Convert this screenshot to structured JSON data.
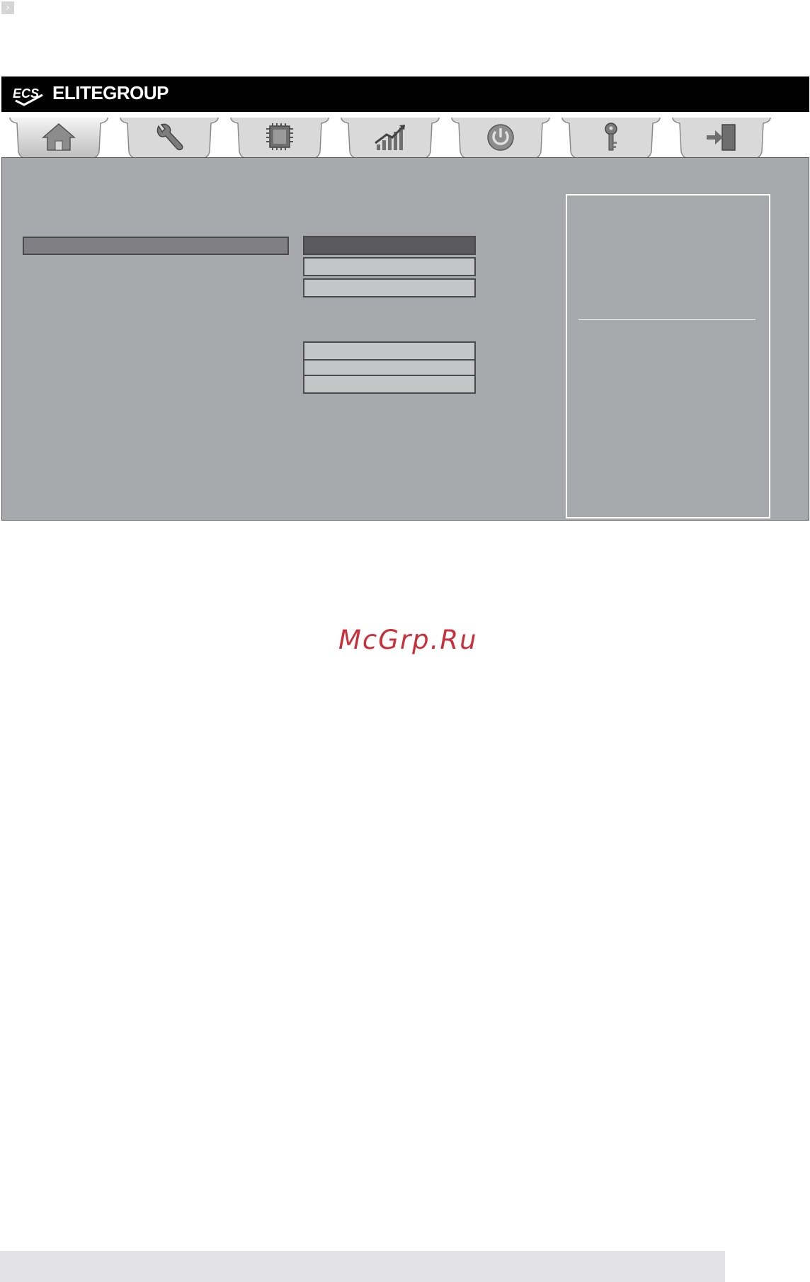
{
  "page": {
    "marker_glyph": "›",
    "watermark": "McGrp.Ru"
  },
  "bios": {
    "brand": {
      "logo_text": "ECS",
      "name": "ELITEGROUP"
    },
    "tabs": [
      {
        "id": "main",
        "icon": "home-icon"
      },
      {
        "id": "advanced",
        "icon": "wrench-icon"
      },
      {
        "id": "chipset",
        "icon": "chip-icon"
      },
      {
        "id": "performance",
        "icon": "bar-chart-icon"
      },
      {
        "id": "power",
        "icon": "power-icon"
      },
      {
        "id": "security",
        "icon": "key-icon"
      },
      {
        "id": "exit",
        "icon": "exit-door-icon"
      }
    ],
    "colors": {
      "content_bg": "#a7a8ab",
      "highlight": "#808084",
      "option_selected": "#5a5a5c",
      "option": "#c4c5c7"
    }
  }
}
